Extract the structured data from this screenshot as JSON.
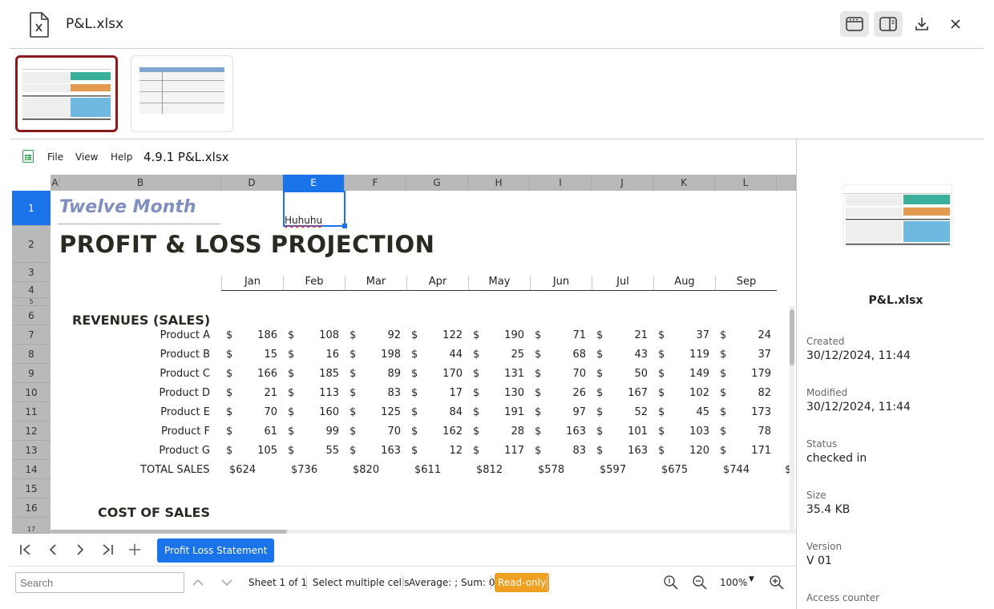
{
  "header": {
    "file_name": "P&L.xlsx"
  },
  "viewer": {
    "menu": [
      "File",
      "View",
      "Help"
    ],
    "doc_title": "4.9.1 P&L.xlsx",
    "columns": [
      "A",
      "B",
      "D",
      "E",
      "F",
      "G",
      "H",
      "I",
      "J",
      "K",
      "L"
    ],
    "selected_column": "E",
    "rows": [
      "1",
      "2",
      "3",
      "4",
      "5",
      "6",
      "7",
      "8",
      "9",
      "10",
      "11",
      "12",
      "13",
      "14",
      "15",
      "16",
      "17"
    ],
    "cells": {
      "title_italic": "Twelve Month",
      "selected_value": "Huhuhu",
      "big_title": "PROFIT & LOSS PROJECTION",
      "months": [
        "Jan",
        "Feb",
        "Mar",
        "Apr",
        "May",
        "Jun",
        "Jul",
        "Aug",
        "Sep"
      ],
      "revenues_heading": "REVENUES (SALES)",
      "currency": "$",
      "products": [
        {
          "name": "Product A",
          "values": [
            "186",
            "108",
            "92",
            "122",
            "190",
            "71",
            "21",
            "37",
            "24"
          ]
        },
        {
          "name": "Product B",
          "values": [
            "15",
            "16",
            "198",
            "44",
            "25",
            "68",
            "43",
            "119",
            "37"
          ]
        },
        {
          "name": "Product C",
          "values": [
            "166",
            "185",
            "89",
            "170",
            "131",
            "70",
            "50",
            "149",
            "179"
          ]
        },
        {
          "name": "Product D",
          "values": [
            "21",
            "113",
            "83",
            "17",
            "130",
            "26",
            "167",
            "102",
            "82"
          ]
        },
        {
          "name": "Product E",
          "values": [
            "70",
            "160",
            "125",
            "84",
            "191",
            "97",
            "52",
            "45",
            "173"
          ]
        },
        {
          "name": "Product F",
          "values": [
            "61",
            "99",
            "70",
            "162",
            "28",
            "163",
            "101",
            "103",
            "78"
          ]
        },
        {
          "name": "Product G",
          "values": [
            "105",
            "55",
            "163",
            "12",
            "117",
            "83",
            "163",
            "120",
            "171"
          ]
        }
      ],
      "total_label": "TOTAL SALES",
      "totals": [
        "$624",
        "$736",
        "$820",
        "$611",
        "$812",
        "$578",
        "$597",
        "$675",
        "$744",
        "$"
      ],
      "cost_heading": "COST OF SALES"
    },
    "sheet_tab": "Profit Loss Statement",
    "status": {
      "search_placeholder": "Search",
      "sheet_info": "Sheet 1 of 1",
      "selection_mode": "Select multiple cells",
      "calc": "Average: ; Sum: 0",
      "readonly": "Read-only",
      "zoom": "100%"
    }
  },
  "panel": {
    "name": "P&L.xlsx",
    "fields": [
      {
        "label": "Created",
        "value": "30/12/2024, 11:44"
      },
      {
        "label": "Modified",
        "value": "30/12/2024, 11:44"
      },
      {
        "label": "Status",
        "value": "checked in"
      },
      {
        "label": "Size",
        "value": "35.4 KB"
      },
      {
        "label": "Version",
        "value": "V 01"
      },
      {
        "label": "Access counter",
        "value": ""
      }
    ]
  },
  "colors": {
    "accent": "#1a73e8",
    "selected_thumb": "#8b1a1a",
    "readonly": "#f0a020"
  }
}
